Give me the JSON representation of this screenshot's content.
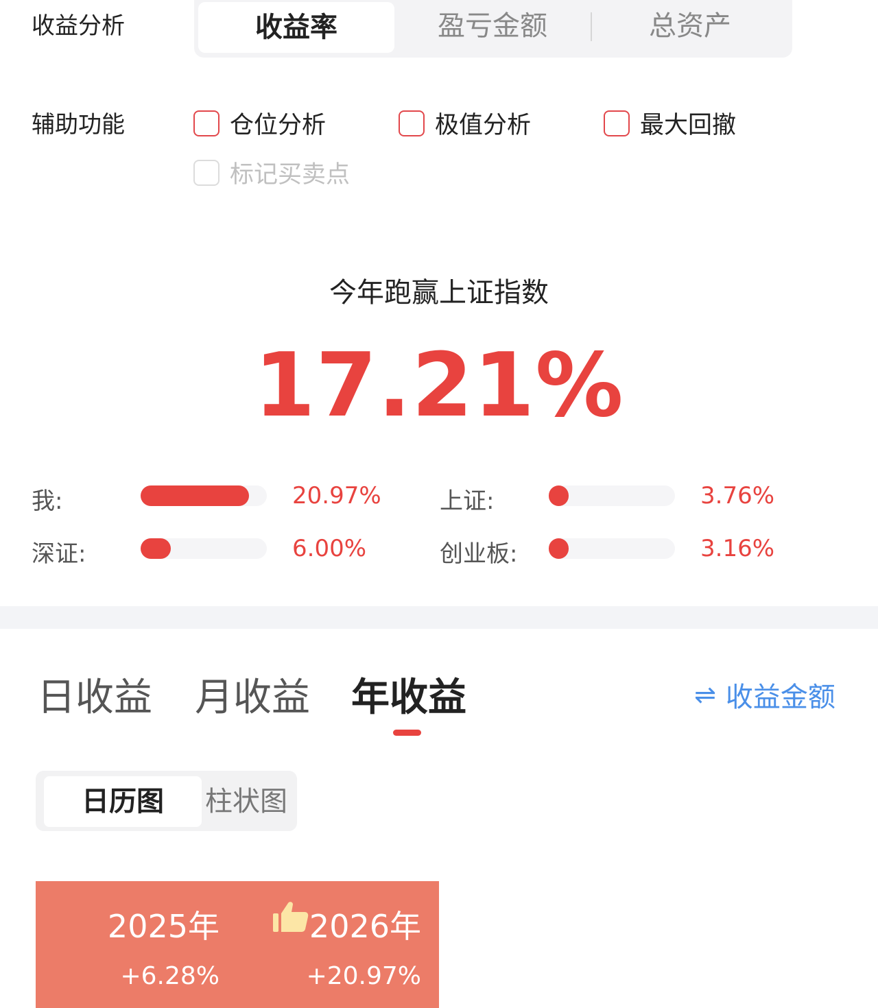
{
  "analysis": {
    "label": "收益分析",
    "tabs": [
      {
        "label": "收益率",
        "active": true
      },
      {
        "label": "盈亏金额",
        "active": false
      },
      {
        "label": "总资产",
        "active": false
      }
    ]
  },
  "aux": {
    "label": "辅助功能",
    "options": [
      {
        "label": "仓位分析",
        "checked": false,
        "disabled": false
      },
      {
        "label": "极值分析",
        "checked": false,
        "disabled": false
      },
      {
        "label": "最大回撤",
        "checked": false,
        "disabled": false
      },
      {
        "label": "标记买卖点",
        "checked": false,
        "disabled": true
      }
    ]
  },
  "summary": {
    "title": "今年跑赢上证指数",
    "value": "17.21%"
  },
  "compare": [
    {
      "label": "我:",
      "percent": "20.97%",
      "fill": 0.86
    },
    {
      "label": "上证:",
      "percent": "3.76%",
      "fill": 0.15
    },
    {
      "label": "深证:",
      "percent": "6.00%",
      "fill": 0.24
    },
    {
      "label": "创业板:",
      "percent": "3.16%",
      "fill": 0.14
    }
  ],
  "period_tabs": [
    {
      "label": "日收益",
      "active": false
    },
    {
      "label": "月收益",
      "active": false
    },
    {
      "label": "年收益",
      "active": true
    }
  ],
  "switch_link": {
    "icon": "swap-arrows-icon",
    "glyph": "⇌",
    "label": "收益金额"
  },
  "view_tabs": [
    {
      "label": "日历图",
      "active": true
    },
    {
      "label": "柱状图",
      "active": false
    }
  ],
  "calendar": [
    {
      "year": "2025年",
      "value": "+6.28%",
      "best": false
    },
    {
      "year": "2026年",
      "value": "+20.97%",
      "best": true,
      "icon": "thumbs-up-icon"
    }
  ],
  "colors": {
    "accent": "#e8433f",
    "link": "#4a8fe8",
    "cell": "#ec7c68",
    "thumb": "#fce6a6"
  }
}
